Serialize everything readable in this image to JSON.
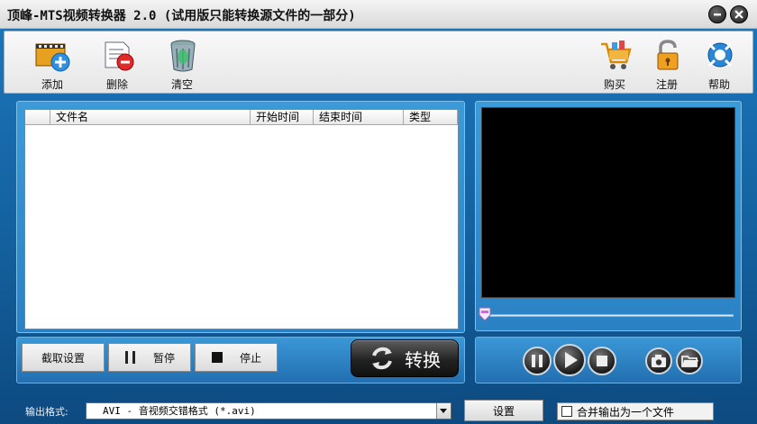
{
  "window": {
    "title": "顶峰-MTS视频转换器 2.0 (试用版只能转换源文件的一部分)"
  },
  "toolbar": {
    "add_label": "添加",
    "delete_label": "删除",
    "clear_label": "清空",
    "buy_label": "购买",
    "register_label": "注册",
    "help_label": "帮助"
  },
  "file_list": {
    "columns": [
      "文件名",
      "开始时间",
      "结束时间",
      "类型"
    ]
  },
  "controls": {
    "crop_settings_label": "截取设置",
    "pause_label": "暂停",
    "stop_label": "停止",
    "convert_label": "转换"
  },
  "output": {
    "format_label": "输出格式:",
    "format_value": "AVI - 音视频交错格式 (*.avi)",
    "settings_label": "设置",
    "merge_label": "合并输出为一个文件"
  },
  "colors": {
    "accent_blue": "#2a82c4",
    "dark_frame": "#0e4f86"
  }
}
